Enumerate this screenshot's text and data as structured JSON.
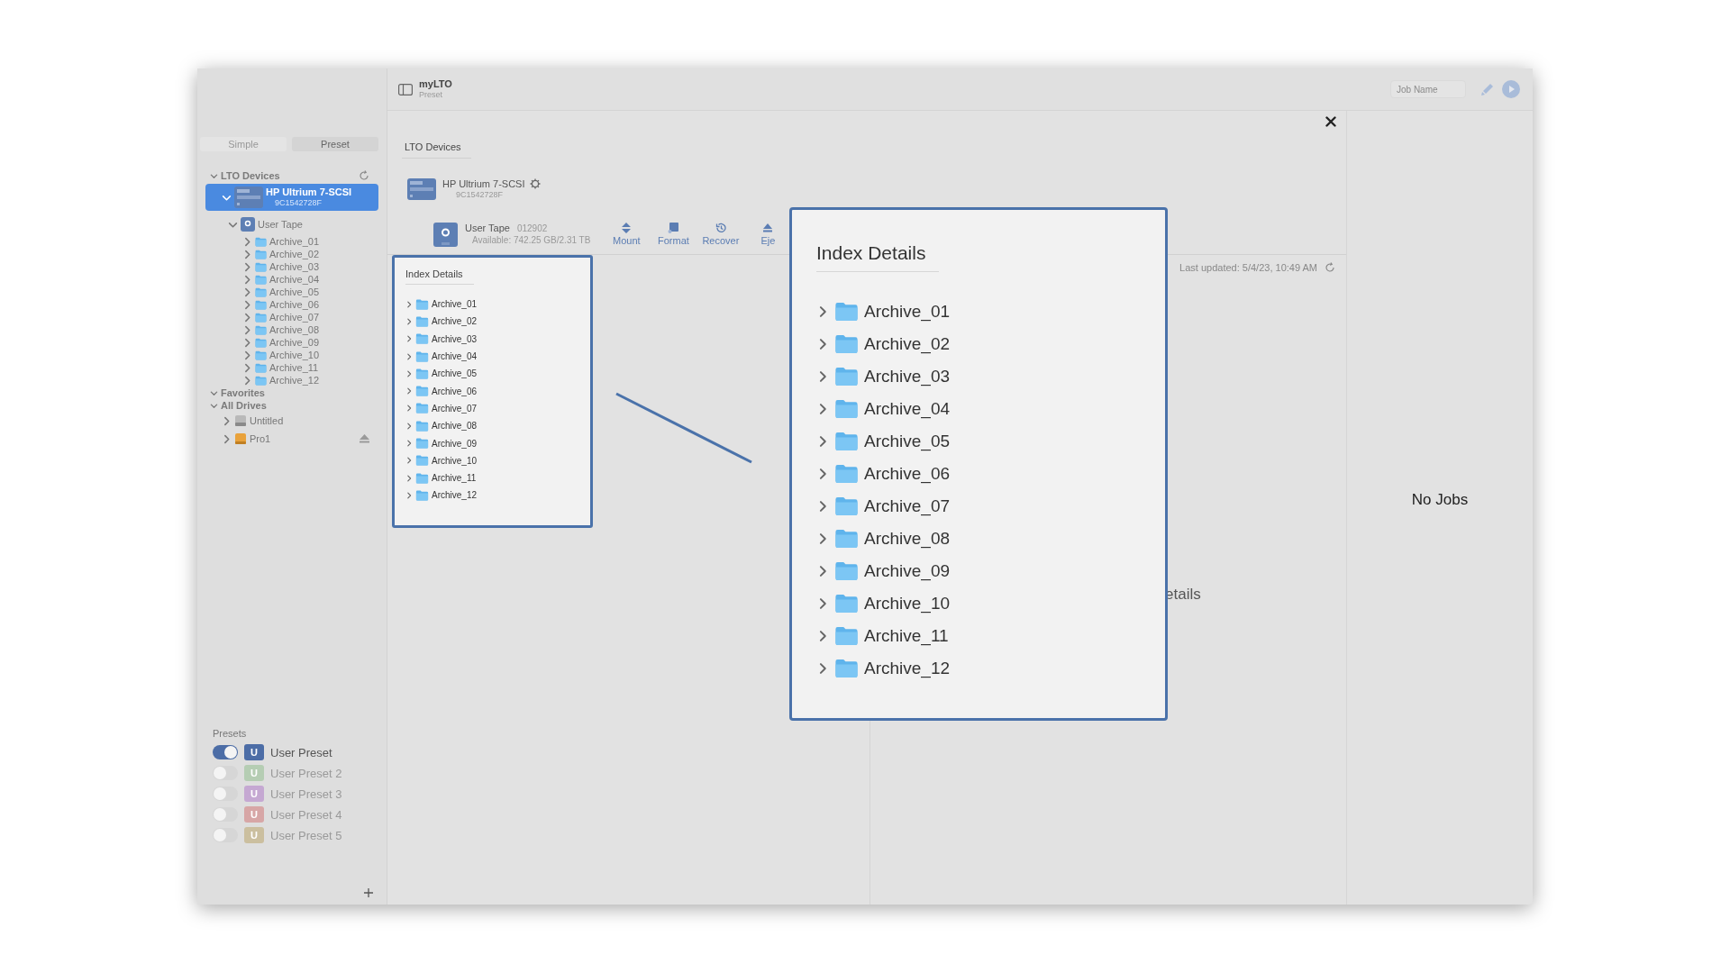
{
  "window": {
    "title": "myLTO",
    "subtitle": "Preset"
  },
  "toolbar": {
    "job_name": {
      "placeholder": "Job Name"
    }
  },
  "sidebar": {
    "mode_tabs": [
      {
        "label": "Simple",
        "selected": false
      },
      {
        "label": "Preset",
        "selected": true
      }
    ],
    "tree": [
      {
        "label": "LTO Devices",
        "kind": "section",
        "expanded": true,
        "selected": false,
        "children": [
          {
            "label": "HP Ultrium 7-SCSI",
            "sublabel": "9C1542728F",
            "kind": "device",
            "expanded": true,
            "selected": true,
            "children": [
              {
                "label": "User Tape",
                "kind": "tape",
                "expanded": true,
                "selected": false,
                "children": [
                  {
                    "label": "Archive_01",
                    "kind": "folder",
                    "expanded": false,
                    "selected": false
                  },
                  {
                    "label": "Archive_02",
                    "kind": "folder",
                    "expanded": false,
                    "selected": false
                  },
                  {
                    "label": "Archive_03",
                    "kind": "folder",
                    "expanded": false,
                    "selected": false
                  },
                  {
                    "label": "Archive_04",
                    "kind": "folder",
                    "expanded": false,
                    "selected": false
                  },
                  {
                    "label": "Archive_05",
                    "kind": "folder",
                    "expanded": false,
                    "selected": false
                  },
                  {
                    "label": "Archive_06",
                    "kind": "folder",
                    "expanded": false,
                    "selected": false
                  },
                  {
                    "label": "Archive_07",
                    "kind": "folder",
                    "expanded": false,
                    "selected": false
                  },
                  {
                    "label": "Archive_08",
                    "kind": "folder",
                    "expanded": false,
                    "selected": false
                  },
                  {
                    "label": "Archive_09",
                    "kind": "folder",
                    "expanded": false,
                    "selected": false
                  },
                  {
                    "label": "Archive_10",
                    "kind": "folder",
                    "expanded": false,
                    "selected": false
                  },
                  {
                    "label": "Archive_11",
                    "kind": "folder",
                    "expanded": false,
                    "selected": false
                  },
                  {
                    "label": "Archive_12",
                    "kind": "folder",
                    "expanded": false,
                    "selected": false
                  }
                ]
              }
            ]
          }
        ]
      },
      {
        "label": "Favorites",
        "kind": "section",
        "expanded": true,
        "selected": false
      },
      {
        "label": "All Drives",
        "kind": "section",
        "expanded": true,
        "selected": false,
        "children": [
          {
            "label": "Untitled",
            "kind": "disk",
            "expanded": false,
            "selected": false
          },
          {
            "label": "Pro1",
            "kind": "drive",
            "expanded": false,
            "selected": false,
            "ejectable": true
          }
        ]
      }
    ],
    "presets": {
      "title": "Presets",
      "items": [
        {
          "label": "User Preset",
          "badge": "U",
          "on": true,
          "color": "#4c6da6"
        },
        {
          "label": "User Preset 2",
          "badge": "U",
          "on": false,
          "color": "#b5cdb3"
        },
        {
          "label": "User Preset 3",
          "badge": "U",
          "on": false,
          "color": "#c5a8d2"
        },
        {
          "label": "User Preset 4",
          "badge": "U",
          "on": false,
          "color": "#d7a6a6"
        },
        {
          "label": "User Preset 5",
          "badge": "U",
          "on": false,
          "color": "#cbbf9f"
        }
      ]
    }
  },
  "devices": {
    "tabs": [
      {
        "label": "LTO Devices",
        "selected": true
      }
    ],
    "device": {
      "name": "HP Ultrium 7-SCSI",
      "serial": "9C1542728F"
    },
    "tape": {
      "name": "User Tape",
      "barcode": "012902",
      "available": "Available: 742.25 GB/2.31 TB"
    },
    "actions": [
      {
        "label": "Mount",
        "kind": "mount"
      },
      {
        "label": "Format",
        "kind": "format"
      },
      {
        "label": "Recover",
        "kind": "recover"
      },
      {
        "label": "Eje",
        "kind": "eject"
      }
    ]
  },
  "index_details": {
    "title": "Index Details",
    "items": [
      {
        "label": "Archive_01",
        "expanded": false
      },
      {
        "label": "Archive_02",
        "expanded": false
      },
      {
        "label": "Archive_03",
        "expanded": false
      },
      {
        "label": "Archive_04",
        "expanded": false
      },
      {
        "label": "Archive_05",
        "expanded": false
      },
      {
        "label": "Archive_06",
        "expanded": false
      },
      {
        "label": "Archive_07",
        "expanded": false
      },
      {
        "label": "Archive_08",
        "expanded": false
      },
      {
        "label": "Archive_09",
        "expanded": false
      },
      {
        "label": "Archive_10",
        "expanded": false
      },
      {
        "label": "Archive_11",
        "expanded": false
      },
      {
        "label": "Archive_12",
        "expanded": false
      }
    ]
  },
  "detail_pane": {
    "last_updated": "Last updated: 5/4/23, 10:49 AM",
    "title": "etails"
  },
  "jobs": {
    "empty_text": "No Jobs"
  },
  "callout": {
    "title": "Index Details",
    "items": [
      {
        "label": "Archive_01",
        "expanded": false
      },
      {
        "label": "Archive_02",
        "expanded": false
      },
      {
        "label": "Archive_03",
        "expanded": false
      },
      {
        "label": "Archive_04",
        "expanded": false
      },
      {
        "label": "Archive_05",
        "expanded": false
      },
      {
        "label": "Archive_06",
        "expanded": false
      },
      {
        "label": "Archive_07",
        "expanded": false
      },
      {
        "label": "Archive_08",
        "expanded": false
      },
      {
        "label": "Archive_09",
        "expanded": false
      },
      {
        "label": "Archive_10",
        "expanded": false
      },
      {
        "label": "Archive_11",
        "expanded": false
      },
      {
        "label": "Archive_12",
        "expanded": false
      }
    ]
  }
}
